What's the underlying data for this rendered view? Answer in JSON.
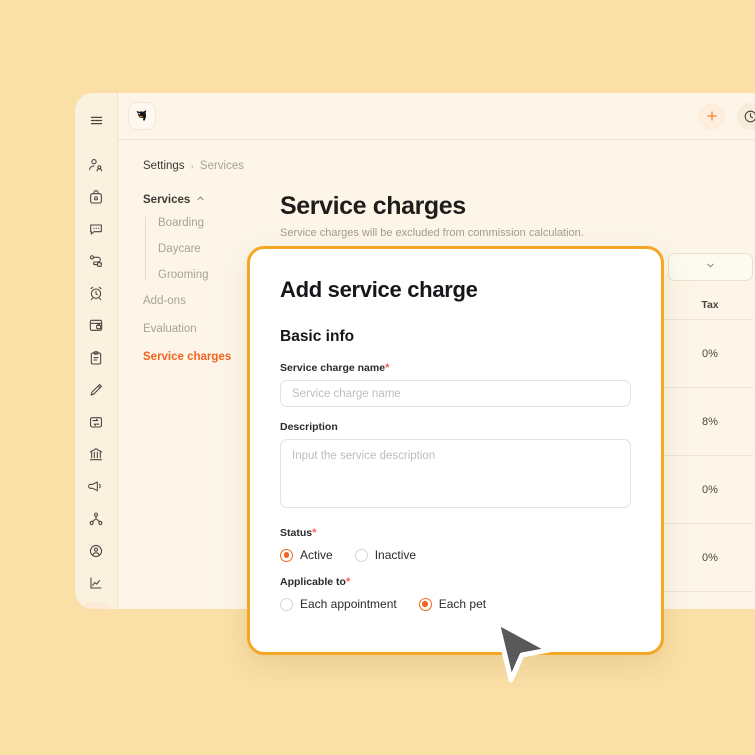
{
  "theme": {
    "page_background": "#fadfa6",
    "window_background": "#fdf6e8",
    "accent_orange": "#f2621f",
    "modal_border": "#f5a623",
    "required_red": "#ff5a4d"
  },
  "rail": {
    "items": [
      {
        "name": "menu-icon",
        "label": "Menu"
      },
      {
        "name": "clients-icon",
        "label": "Clients"
      },
      {
        "name": "pet-bag-icon",
        "label": "Pets"
      },
      {
        "name": "messages-icon",
        "label": "Messages"
      },
      {
        "name": "workflow-icon",
        "label": "Workflow"
      },
      {
        "name": "alarm-icon",
        "label": "Reminders"
      },
      {
        "name": "calendar-lock-icon",
        "label": "Bookings"
      },
      {
        "name": "clipboard-icon",
        "label": "Tasks"
      },
      {
        "name": "pencil-icon",
        "label": "Notes"
      },
      {
        "name": "repeat-calendar-icon",
        "label": "Recurring"
      },
      {
        "name": "bank-icon",
        "label": "Payments"
      },
      {
        "name": "megaphone-icon",
        "label": "Marketing"
      },
      {
        "name": "hierarchy-icon",
        "label": "Team"
      },
      {
        "name": "user-heart-icon",
        "label": "Staff"
      },
      {
        "name": "chart-icon",
        "label": "Reports"
      },
      {
        "name": "gear-icon",
        "label": "Settings"
      }
    ],
    "active_index": 15
  },
  "header": {
    "logo_name": "dog-head-logo",
    "add_label": "+",
    "buttons": [
      {
        "name": "add-button",
        "icon": "plus-icon"
      },
      {
        "name": "history-button",
        "icon": "clock-icon"
      }
    ]
  },
  "breadcrumb": {
    "root": "Settings",
    "separator": "›",
    "current": "Services"
  },
  "subnav": {
    "group_label": "Services",
    "group_collapse_icon": "chevron-up-icon",
    "children": [
      "Boarding",
      "Daycare",
      "Grooming"
    ],
    "items": [
      "Add-ons",
      "Evaluation",
      "Service charges"
    ],
    "active_item": "Service charges"
  },
  "main": {
    "title": "Service charges",
    "subtitle": "Service charges will be excluded from commission calculation.",
    "dropdown_icon": "chevron-down-icon",
    "table": {
      "columns": [
        "Tax"
      ],
      "rows": [
        {
          "tax": "0%"
        },
        {
          "tax": "8%"
        },
        {
          "tax": "0%"
        },
        {
          "tax": "0%"
        }
      ]
    }
  },
  "modal": {
    "title": "Add service charge",
    "section_title": "Basic info",
    "fields": {
      "name": {
        "label": "Service charge name",
        "required_marker": "*",
        "value": "",
        "placeholder": "Service charge name"
      },
      "description": {
        "label": "Description",
        "value": "",
        "placeholder": "Input the service description"
      },
      "status": {
        "label": "Status",
        "required_marker": "*",
        "options": [
          "Active",
          "Inactive"
        ],
        "selected": "Active"
      },
      "applicable_to": {
        "label": "Applicable to",
        "required_marker": "*",
        "options": [
          "Each appointment",
          "Each pet"
        ],
        "selected": "Each pet"
      }
    }
  },
  "cursor": {
    "name": "mouse-pointer"
  }
}
